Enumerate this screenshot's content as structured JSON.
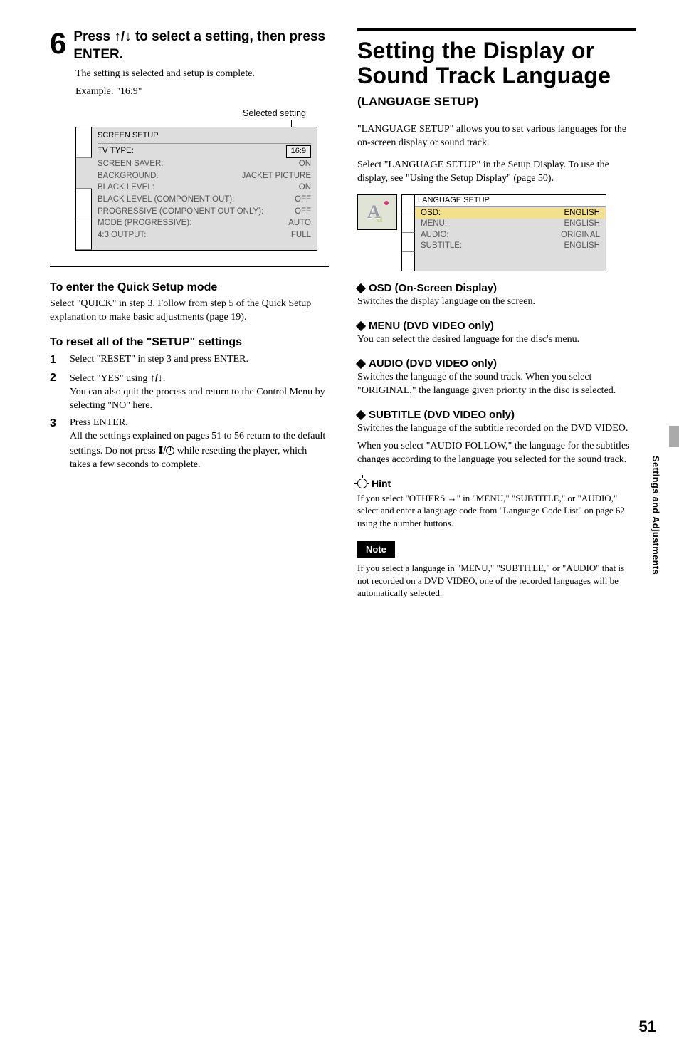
{
  "left": {
    "step6_label_prefix": "6",
    "step6_heading_a": "Press ",
    "step6_arrows": "↑/↓",
    "step6_heading_b": " to select a setting, then press ENTER.",
    "step6_body1": "The setting is selected and setup is complete.",
    "step6_body2": "Example: \"16:9\"",
    "selected_setting_label": "Selected setting",
    "panel": {
      "title": "SCREEN SETUP",
      "rows": [
        {
          "k": "TV TYPE:",
          "v": "16:9",
          "boxed": true
        },
        {
          "k": "SCREEN SAVER:",
          "v": "ON"
        },
        {
          "k": "BACKGROUND:",
          "v": "JACKET PICTURE"
        },
        {
          "k": "BLACK LEVEL:",
          "v": "ON"
        },
        {
          "k": "BLACK LEVEL (COMPONENT OUT):",
          "v": "OFF"
        },
        {
          "k": "PROGRESSIVE (COMPONENT OUT ONLY):",
          "v": "OFF"
        },
        {
          "k": "MODE (PROGRESSIVE):",
          "v": "AUTO"
        },
        {
          "k": "4:3 OUTPUT:",
          "v": "FULL"
        }
      ]
    },
    "quick_head": "To enter the Quick Setup mode",
    "quick_body": "Select \"QUICK\" in step 3. Follow from step 5 of the Quick Setup explanation to make basic adjustments (page 19).",
    "reset_head": "To reset all of the \"SETUP\" settings",
    "reset_steps": {
      "s1": "Select \"RESET\" in step 3 and press ENTER.",
      "s2a": "Select \"YES\" using ",
      "s2arrows": "↑/↓",
      "s2a_end": ".",
      "s2b": "You can also quit the process and return to the Control Menu by selecting \"NO\" here.",
      "s3a": "Press ENTER.",
      "s3b_a": "All the settings explained on pages 51 to 56 return to the default settings. Do not press ",
      "s3b_mid": " while resetting the player, which takes a few seconds to complete.",
      "power_prefix": "𝗜/"
    }
  },
  "right": {
    "title1": "Setting the Display or Sound Track Language",
    "subtitle": "(LANGUAGE SETUP)",
    "intro": "\"LANGUAGE SETUP\" allows you to set various languages for the on-screen display or sound track.",
    "select_para": "Select \"LANGUAGE SETUP\" in the Setup Display. To use the display, see \"Using the Setup Display\" (page 50).",
    "lang_panel": {
      "title": "LANGUAGE SETUP",
      "rows": [
        {
          "k": "OSD:",
          "v": "ENGLISH",
          "hl": true
        },
        {
          "k": "MENU:",
          "v": "ENGLISH"
        },
        {
          "k": "AUDIO:",
          "v": "ORIGINAL"
        },
        {
          "k": "SUBTITLE:",
          "v": "ENGLISH"
        }
      ]
    },
    "osd_head": "OSD (On-Screen Display)",
    "osd_body": "Switches the display language on the screen.",
    "menu_head": "MENU (DVD VIDEO only)",
    "menu_body": "You can select the desired language for the disc's menu.",
    "audio_head": "AUDIO (DVD VIDEO only)",
    "audio_body": "Switches the language of the sound track. When you select \"ORIGINAL,\" the language given priority in the disc is selected.",
    "subtitle_head": "SUBTITLE (DVD VIDEO only)",
    "subtitle_body1": "Switches the language of the subtitle recorded on the DVD VIDEO.",
    "subtitle_body2": "When you select \"AUDIO FOLLOW,\" the language for the subtitles changes according to the language you selected for the sound track.",
    "hint_label": "Hint",
    "hint_body_a": "If you select \"OTHERS ",
    "hint_arrow": "→",
    "hint_body_b": "\" in \"MENU,\" \"SUBTITLE,\" or \"AUDIO,\" select and enter a language code from \"Language Code List\" on page 62 using the number buttons.",
    "note_label": "Note",
    "note_body": "If you select a language in \"MENU,\" \"SUBTITLE,\" or \"AUDIO\" that is not recorded on a DVD VIDEO, one of the recorded languages will be automatically selected."
  },
  "side": {
    "section": "Settings and Adjustments",
    "page": "51"
  }
}
